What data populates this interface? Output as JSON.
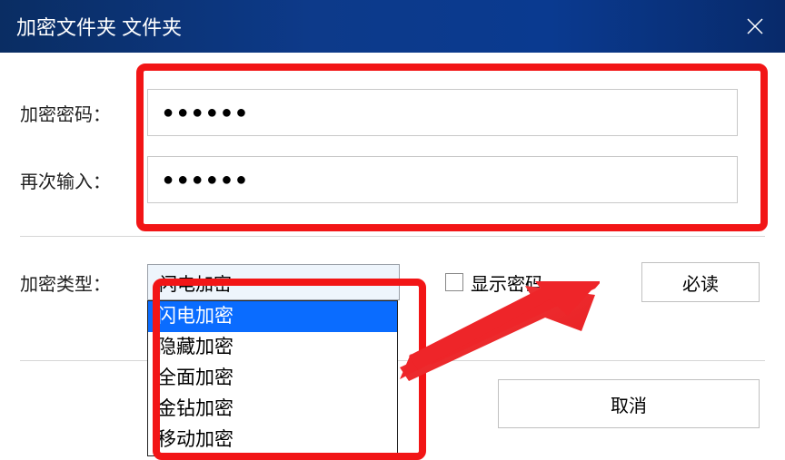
{
  "titlebar": {
    "title": "加密文件夹 文件夹"
  },
  "form": {
    "password_label": "加密密码：",
    "password_value": "●●●●●●",
    "confirm_label": "再次输入：",
    "confirm_value": "●●●●●●",
    "type_label": "加密类型：",
    "type_selected": "闪电加密",
    "type_options": [
      "闪电加密",
      "隐藏加密",
      "全面加密",
      "金钻加密",
      "移动加密"
    ],
    "show_password_label": "显示密码",
    "required_button": "必读",
    "cancel_button": "取消"
  },
  "annotations": {
    "highlight_color": "#f21516",
    "arrow_color": "#ee2529"
  }
}
